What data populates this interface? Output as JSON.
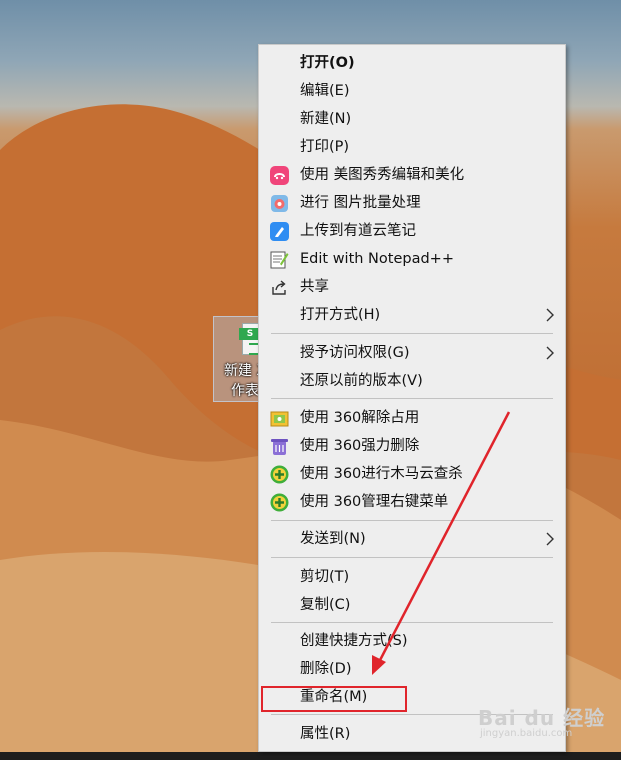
{
  "desktop_icon": {
    "badge": "S",
    "label_line1": "新建 X",
    "label_line2": "作表"
  },
  "context_menu": {
    "items": [
      {
        "label": "打开(O)"
      },
      {
        "label": "编辑(E)"
      },
      {
        "label": "新建(N)"
      },
      {
        "label": "打印(P)"
      },
      {
        "label": "使用 美图秀秀编辑和美化",
        "icon": "meitu-icon"
      },
      {
        "label": "进行 图片批量处理",
        "icon": "batch-image-icon"
      },
      {
        "label": "上传到有道云笔记",
        "icon": "youdao-note-icon"
      },
      {
        "label": "Edit with Notepad++",
        "icon": "notepad-plus-plus-icon"
      },
      {
        "label": "共享",
        "icon": "share-icon"
      },
      {
        "label": "打开方式(H)"
      },
      {
        "label": "授予访问权限(G)"
      },
      {
        "label": "还原以前的版本(V)"
      },
      {
        "label": "使用 360解除占用",
        "icon": "360-unlock-icon"
      },
      {
        "label": "使用 360强力删除",
        "icon": "360-force-delete-icon"
      },
      {
        "label": "使用 360进行木马云查杀",
        "icon": "360-trojan-scan-icon"
      },
      {
        "label": "使用 360管理右键菜单",
        "icon": "360-menu-manager-icon"
      },
      {
        "label": "发送到(N)"
      },
      {
        "label": "剪切(T)"
      },
      {
        "label": "复制(C)"
      },
      {
        "label": "创建快捷方式(S)"
      },
      {
        "label": "删除(D)"
      },
      {
        "label": "重命名(M)"
      },
      {
        "label": "属性(R)"
      }
    ]
  },
  "watermark": {
    "brand": "Bai du 经验",
    "sub": "jingyan.baidu.com"
  },
  "colors": {
    "menu_bg": "#eeeeee",
    "highlight": "#e0242b",
    "arrow": "#e0242b"
  }
}
